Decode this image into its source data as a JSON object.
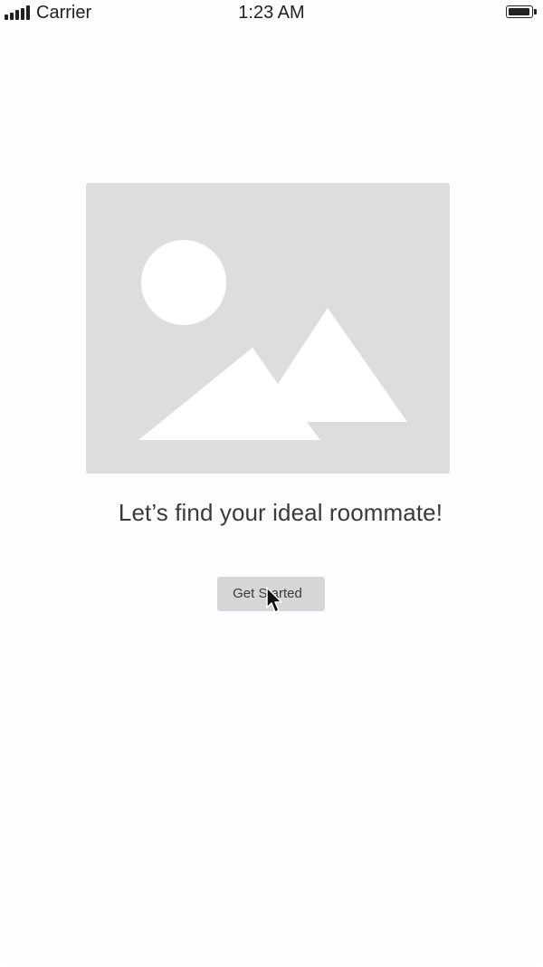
{
  "status_bar": {
    "carrier": "Carrier",
    "time": "1:23 AM",
    "signal_icon": "signal-bars-icon",
    "battery_icon": "battery-icon",
    "battery_level": 1.0
  },
  "hero": {
    "image_icon": "image-placeholder-icon"
  },
  "headline": "Let’s find your ideal roommate!",
  "get_started_label": "Get Started",
  "colors": {
    "background": "#fefdfe",
    "placeholder": "#dddcde",
    "button": "#d6d5d8",
    "text": "#3a3a3d"
  }
}
